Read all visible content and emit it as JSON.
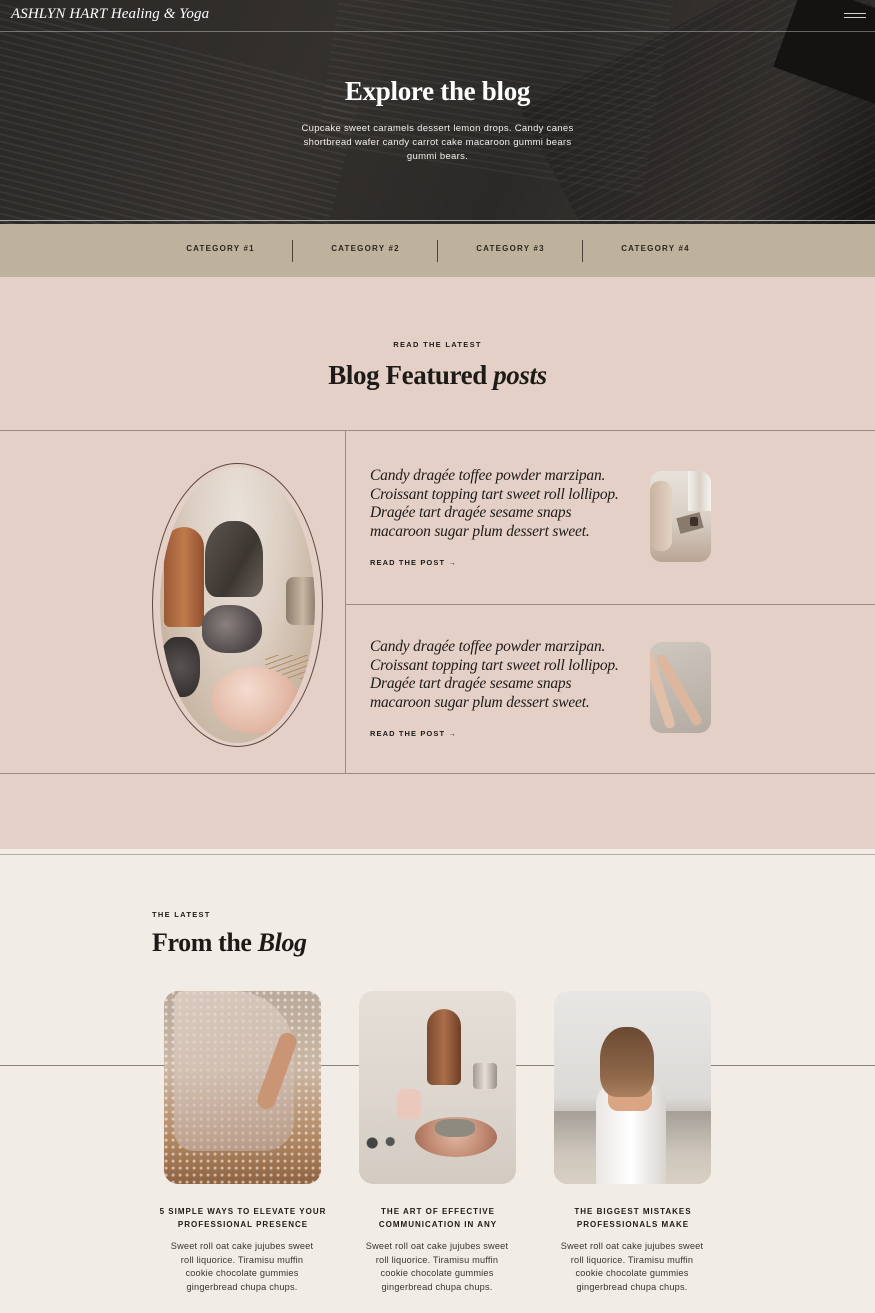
{
  "header": {
    "brand": "ASHLYN HART Healing & Yoga",
    "menu_icon": "hamburger-menu-icon"
  },
  "hero": {
    "title": "Explore the blog",
    "text": "Cupcake sweet caramels dessert lemon drops. Candy canes shortbread wafer candy carrot cake macaroon gummi bears gummi bears."
  },
  "categories": [
    "CATEGORY #1",
    "CATEGORY #2",
    "CATEGORY #3",
    "CATEGORY #4"
  ],
  "featured": {
    "eyebrow": "READ THE LATEST",
    "title_main": "Blog Featured",
    "title_italic": "posts",
    "posts": [
      {
        "text": "Candy dragée toffee powder marzipan. Croissant topping tart sweet roll lollipop. Dragée tart dragée sesame snaps macaroon sugar plum dessert sweet.",
        "link": "READ THE POST →"
      },
      {
        "text": "Candy dragée toffee powder marzipan. Croissant topping tart sweet roll lollipop. Dragée tart dragée sesame snaps macaroon sugar plum dessert sweet.",
        "link": "READ THE POST →"
      }
    ]
  },
  "blog": {
    "eyebrow": "THE LATEST",
    "title_main": "From the",
    "title_italic": "Blog",
    "cards": [
      {
        "title": "5 SIMPLE WAYS TO ELEVATE YOUR PROFESSIONAL PRESENCE",
        "body": "Sweet roll oat cake jujubes sweet roll liquorice. Tiramisu muffin cookie chocolate gummies gingerbread chupa chups."
      },
      {
        "title": "THE ART OF EFFECTIVE COMMUNICATION IN ANY",
        "body": "Sweet roll oat cake jujubes sweet roll liquorice. Tiramisu muffin cookie chocolate gummies gingerbread chupa chups."
      },
      {
        "title": "THE BIGGEST MISTAKES PROFESSIONALS MAKE",
        "body": "Sweet roll oat cake jujubes sweet roll liquorice. Tiramisu muffin cookie chocolate gummies gingerbread chupa chups."
      }
    ]
  },
  "colors": {
    "hero_bg": "#2e2b29",
    "category_bar": "#bfb29d",
    "featured_bg": "#e5d0c8",
    "page_bg": "#f1ede6"
  }
}
